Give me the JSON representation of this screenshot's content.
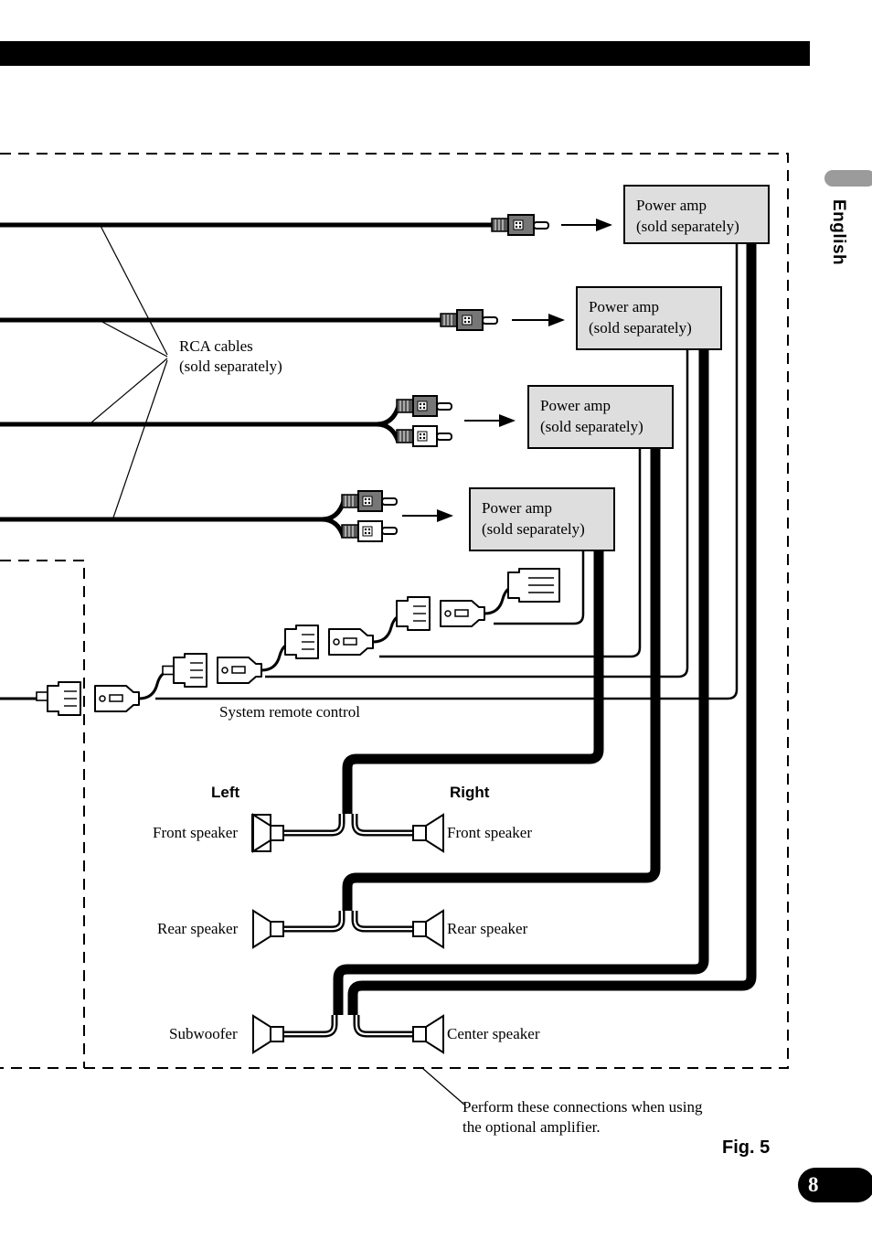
{
  "document": {
    "figure_label": "Fig. 5",
    "page_number": "8",
    "language_tab": "English"
  },
  "labels": {
    "rca_cables": "RCA cables",
    "rca_cables_note": "(sold separately)",
    "system_remote_control": "System remote control",
    "left": "Left",
    "right": "Right",
    "footnote_line1": "Perform these connections when using",
    "footnote_line2": "the optional amplifier."
  },
  "amplifiers": [
    {
      "title": "Power amp",
      "note": "(sold separately)"
    },
    {
      "title": "Power amp",
      "note": "(sold separately)"
    },
    {
      "title": "Power amp",
      "note": "(sold separately)"
    },
    {
      "title": "Power amp",
      "note": "(sold separately)"
    }
  ],
  "speakers": {
    "rows": [
      {
        "left_label": "Front speaker",
        "right_label": "Front speaker"
      },
      {
        "left_label": "Rear speaker",
        "right_label": "Rear speaker"
      },
      {
        "left_label": "Subwoofer",
        "right_label": "Center speaker"
      }
    ]
  },
  "colors": {
    "amp_fill": "#dedede",
    "line": "#000000",
    "tab_gray": "#9b9b9b",
    "rca_left_plug": "#767676",
    "rca_right_plug": "#ffffff"
  }
}
